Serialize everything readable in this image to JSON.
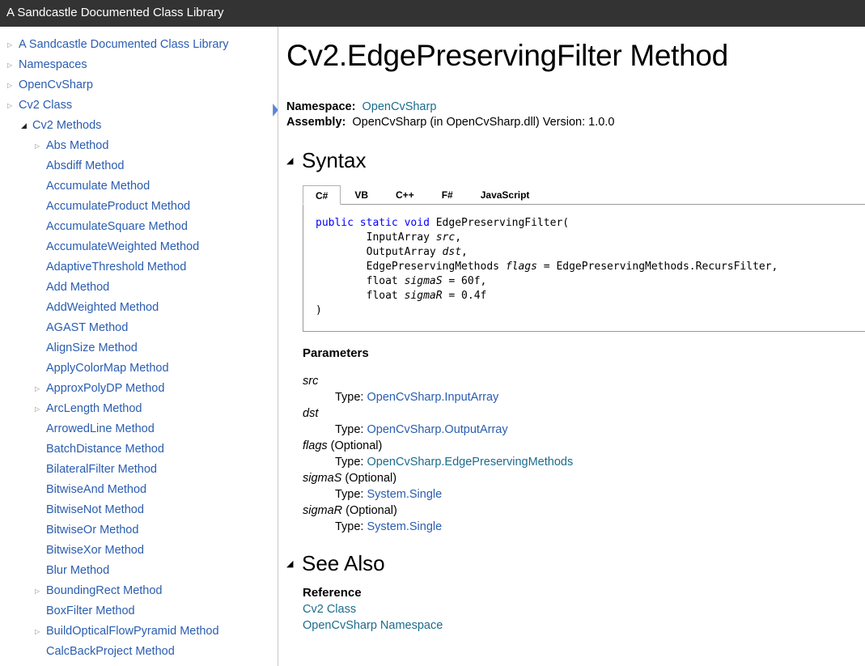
{
  "topbar": {
    "title": "A Sandcastle Documented Class Library"
  },
  "colors": {
    "topbar_bg": "#333333",
    "link_blue": "#2a5db0",
    "link_teal": "#1c6c8c",
    "keyword_blue": "#0000ff"
  },
  "sidebar": {
    "items": [
      {
        "label": "A Sandcastle Documented Class Library",
        "level": 0,
        "toggle": "collapsed"
      },
      {
        "label": "Namespaces",
        "level": 0,
        "toggle": "collapsed"
      },
      {
        "label": "OpenCvSharp",
        "level": 0,
        "toggle": "collapsed"
      },
      {
        "label": "Cv2 Class",
        "level": 0,
        "toggle": "collapsed"
      },
      {
        "label": "Cv2 Methods",
        "level": 1,
        "toggle": "expanded"
      },
      {
        "label": "Abs Method",
        "level": 2,
        "toggle": "collapsed"
      },
      {
        "label": "Absdiff Method",
        "level": 2,
        "toggle": "none"
      },
      {
        "label": "Accumulate Method",
        "level": 2,
        "toggle": "none"
      },
      {
        "label": "AccumulateProduct Method",
        "level": 2,
        "toggle": "none"
      },
      {
        "label": "AccumulateSquare Method",
        "level": 2,
        "toggle": "none"
      },
      {
        "label": "AccumulateWeighted Method",
        "level": 2,
        "toggle": "none"
      },
      {
        "label": "AdaptiveThreshold Method",
        "level": 2,
        "toggle": "none"
      },
      {
        "label": "Add Method",
        "level": 2,
        "toggle": "none"
      },
      {
        "label": "AddWeighted Method",
        "level": 2,
        "toggle": "none"
      },
      {
        "label": "AGAST Method",
        "level": 2,
        "toggle": "none"
      },
      {
        "label": "AlignSize Method",
        "level": 2,
        "toggle": "none"
      },
      {
        "label": "ApplyColorMap Method",
        "level": 2,
        "toggle": "none"
      },
      {
        "label": "ApproxPolyDP Method",
        "level": 2,
        "toggle": "collapsed"
      },
      {
        "label": "ArcLength Method",
        "level": 2,
        "toggle": "collapsed"
      },
      {
        "label": "ArrowedLine Method",
        "level": 2,
        "toggle": "none"
      },
      {
        "label": "BatchDistance Method",
        "level": 2,
        "toggle": "none"
      },
      {
        "label": "BilateralFilter Method",
        "level": 2,
        "toggle": "none"
      },
      {
        "label": "BitwiseAnd Method",
        "level": 2,
        "toggle": "none"
      },
      {
        "label": "BitwiseNot Method",
        "level": 2,
        "toggle": "none"
      },
      {
        "label": "BitwiseOr Method",
        "level": 2,
        "toggle": "none"
      },
      {
        "label": "BitwiseXor Method",
        "level": 2,
        "toggle": "none"
      },
      {
        "label": "Blur Method",
        "level": 2,
        "toggle": "none"
      },
      {
        "label": "BoundingRect Method",
        "level": 2,
        "toggle": "collapsed"
      },
      {
        "label": "BoxFilter Method",
        "level": 2,
        "toggle": "none"
      },
      {
        "label": "BuildOpticalFlowPyramid Method",
        "level": 2,
        "toggle": "collapsed"
      },
      {
        "label": "CalcBackProject Method",
        "level": 2,
        "toggle": "none"
      }
    ]
  },
  "main": {
    "title": "Cv2.EdgePreservingFilter Method",
    "namespace_label": "Namespace:",
    "namespace_value": "OpenCvSharp",
    "assembly_label": "Assembly:",
    "assembly_value": "OpenCvSharp (in OpenCvSharp.dll) Version: 1.0.0",
    "syntax_heading": "Syntax",
    "tabs": [
      {
        "label": "C#",
        "active": true
      },
      {
        "label": "VB",
        "active": false
      },
      {
        "label": "C++",
        "active": false
      },
      {
        "label": "F#",
        "active": false
      },
      {
        "label": "JavaScript",
        "active": false
      }
    ],
    "code": {
      "kw1": "public",
      "kw2": "static",
      "kw3": "void",
      "method": "EdgePreservingFilter(",
      "lines": [
        {
          "type": "InputArray",
          "name": "src",
          "rest": ","
        },
        {
          "type": "OutputArray",
          "name": "dst",
          "rest": ","
        },
        {
          "type": "EdgePreservingMethods",
          "name": "flags",
          "rest": " = EdgePreservingMethods.RecursFilter,"
        },
        {
          "type": "float",
          "name": "sigmaS",
          "rest": " = 60f,"
        },
        {
          "type": "float",
          "name": "sigmaR",
          "rest": " = 0.4f"
        }
      ],
      "close": ")"
    },
    "parameters_heading": "Parameters",
    "parameters": [
      {
        "name": "src",
        "optional": "",
        "type_label": "Type:",
        "type": "OpenCvSharp.InputArray",
        "link_style": "blue"
      },
      {
        "name": "dst",
        "optional": "",
        "type_label": "Type:",
        "type": "OpenCvSharp.OutputArray",
        "link_style": "blue"
      },
      {
        "name": "flags",
        "optional": " (Optional)",
        "type_label": "Type:",
        "type": "OpenCvSharp.EdgePreservingMethods",
        "link_style": "teal"
      },
      {
        "name": "sigmaS",
        "optional": " (Optional)",
        "type_label": "Type:",
        "type": "System.Single",
        "link_style": "blue"
      },
      {
        "name": "sigmaR",
        "optional": " (Optional)",
        "type_label": "Type:",
        "type": "System.Single",
        "link_style": "blue"
      }
    ],
    "see_also_heading": "See Also",
    "reference_heading": "Reference",
    "references": [
      {
        "label": "Cv2 Class"
      },
      {
        "label": "OpenCvSharp Namespace"
      }
    ]
  }
}
